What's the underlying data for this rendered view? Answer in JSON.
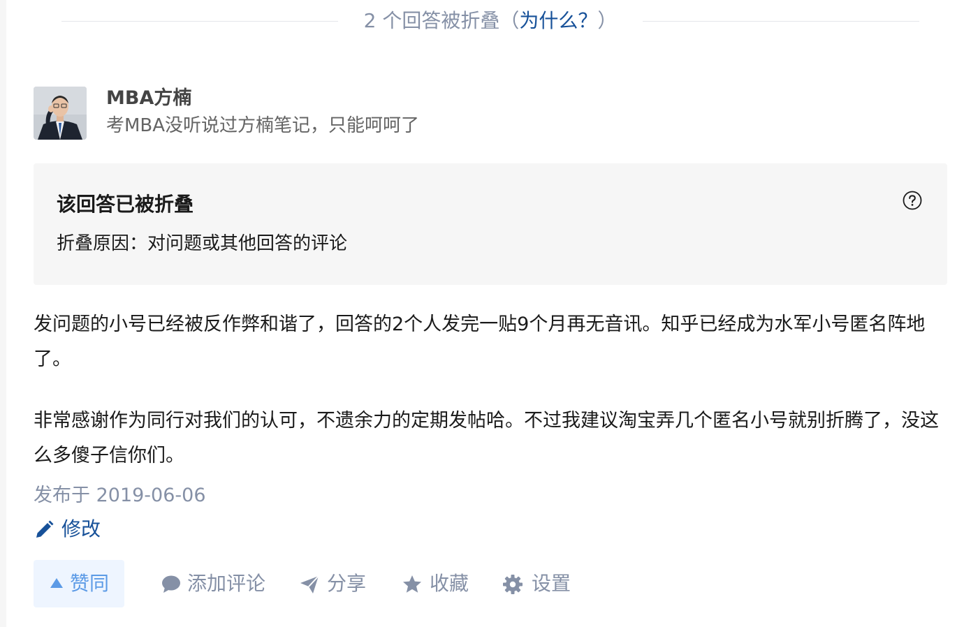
{
  "collapsed_banner": {
    "prefix": "2 个回答被折叠（",
    "why_link": "为什么？",
    "suffix": "）"
  },
  "author": {
    "name": "MBA方楠",
    "bio": "考MBA没听说过方楠笔记，只能呵呵了"
  },
  "fold_notice": {
    "title": "该回答已被折叠",
    "reason": "折叠原因：对问题或其他回答的评论"
  },
  "answer": {
    "paragraphs": [
      "发问题的小号已经被反作弊和谐了，回答的2个人发完一贴9个月再无音讯。知乎已经成为水军小号匿名阵地了。",
      "非常感谢作为同行对我们的认可，不遗余力的定期发帖哈。不过我建议淘宝弄几个匿名小号就别折腾了，没这么多傻子信你们。"
    ],
    "published": "发布于 2019-06-06",
    "edit_label": "修改"
  },
  "actions": {
    "vote_label": "赞同",
    "comment_label": "添加评论",
    "share_label": "分享",
    "collect_label": "收藏",
    "settings_label": "设置"
  },
  "colors": {
    "link_blue": "#175199",
    "meta_gray": "#8590a6",
    "vote_bg": "#eef5ff",
    "vote_fg": "#5b9ae6",
    "fold_bg": "#f6f6f6"
  },
  "icons": [
    "help-circle-icon",
    "pencil-icon",
    "triangle-up-icon",
    "comment-bubble-icon",
    "paper-plane-icon",
    "star-icon",
    "gear-icon"
  ]
}
